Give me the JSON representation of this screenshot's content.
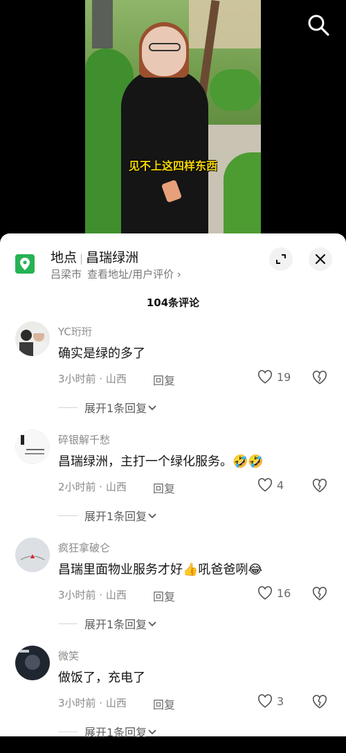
{
  "video": {
    "caption": "见不上这四样东西",
    "search_icon": "search-icon"
  },
  "location": {
    "label": "地点",
    "separator": "|",
    "name": "昌瑞绿洲",
    "city": "吕梁市",
    "link": "查看地址/用户评价 ›",
    "icon": "location-pin-icon",
    "icon_color": "#27b254"
  },
  "header": {
    "comment_count": "104条评论"
  },
  "comments": [
    {
      "username": "YC珩珩",
      "text": "确实是绿的多了",
      "meta": "3小时前 · 山西",
      "reply": "回复",
      "likes": "19",
      "expand": "展开1条回复"
    },
    {
      "username": "碎银解千愁",
      "text": "昌瑞绿洲，主打一个绿化服务。🤣🤣",
      "meta": "2小时前 · 山西",
      "reply": "回复",
      "likes": "4",
      "expand": "展开1条回复"
    },
    {
      "username": "疯狂拿破仑",
      "text": "昌瑞里面物业服务才好👍吼爸爸咧😂",
      "meta": "3小时前 · 山西",
      "reply": "回复",
      "likes": "16",
      "expand": "展开1条回复"
    },
    {
      "username": "微笑",
      "text": "做饭了，充电了",
      "meta": "3小时前 · 山西",
      "reply": "回复",
      "likes": "3",
      "expand": "展开1条回复"
    }
  ]
}
